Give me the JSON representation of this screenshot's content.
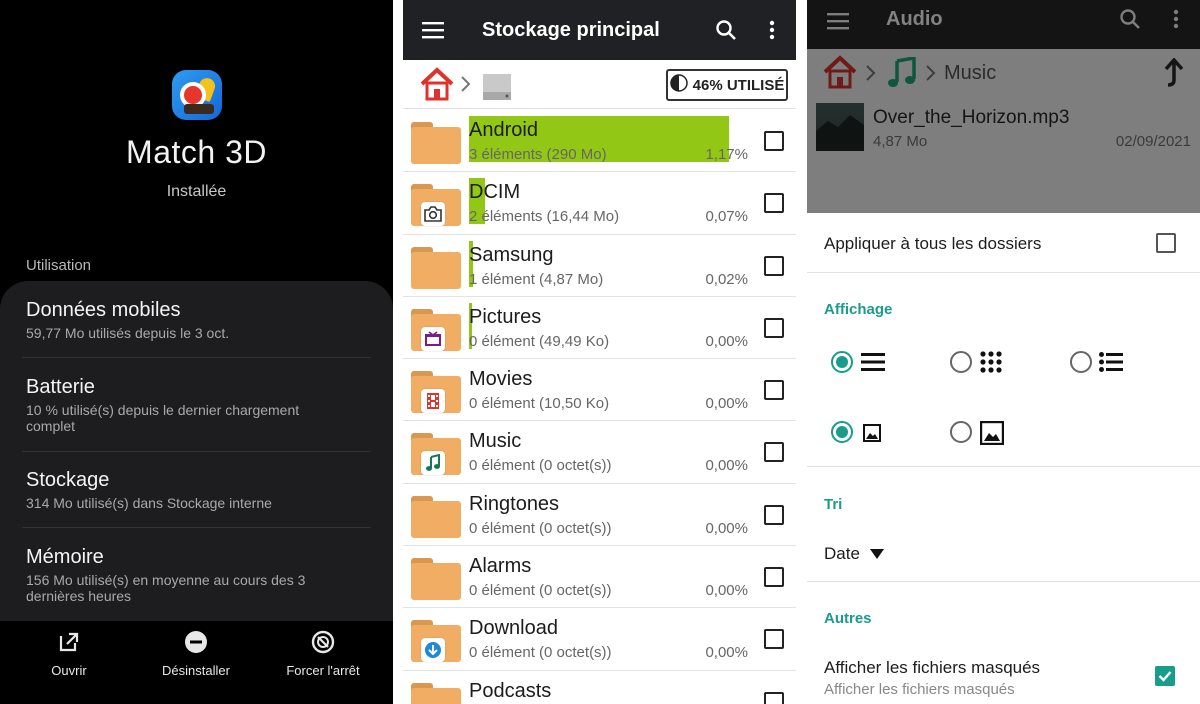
{
  "app_info": {
    "app_name": "Match 3D",
    "status": "Installée",
    "section_label": "Utilisation",
    "rows": [
      {
        "title": "Données mobiles",
        "subtitle": "59,77 Mo utilisés depuis le 3 oct."
      },
      {
        "title": "Batterie",
        "subtitle": "10 % utilisé(s) depuis le dernier chargement complet"
      },
      {
        "title": "Stockage",
        "subtitle": "314 Mo utilisé(s) dans Stockage interne"
      },
      {
        "title": "Mémoire",
        "subtitle": "156 Mo utilisé(s) en moyenne au cours des 3 dernières heures"
      }
    ],
    "actions": [
      {
        "label": "Ouvrir",
        "icon": "open-external-icon"
      },
      {
        "label": "Désinstaller",
        "icon": "uninstall-icon"
      },
      {
        "label": "Forcer l'arrêt",
        "icon": "force-stop-icon"
      }
    ]
  },
  "storage": {
    "title": "Stockage principal",
    "usage_label": "46% UTILISÉ",
    "bar_color": "#92c815",
    "folders": [
      {
        "name": "Android",
        "meta": "3 éléments (290 Mo)",
        "percent": "1,17%",
        "bar_fraction": 1.0,
        "icon": "folder-icon"
      },
      {
        "name": "DCIM",
        "meta": "2 éléments (16,44 Mo)",
        "percent": "0,07%",
        "bar_fraction": 0.06,
        "icon": "camera-icon"
      },
      {
        "name": "Samsung",
        "meta": "1 élément (4,87 Mo)",
        "percent": "0,02%",
        "bar_fraction": 0.017,
        "icon": "folder-icon"
      },
      {
        "name": "Pictures",
        "meta": "0 élément (49,49 Ko)",
        "percent": "0,00%",
        "bar_fraction": 0.004,
        "icon": "picture-icon"
      },
      {
        "name": "Movies",
        "meta": "0 élément (10,50 Ko)",
        "percent": "0,00%",
        "bar_fraction": 0,
        "icon": "film-icon"
      },
      {
        "name": "Music",
        "meta": "0 élément (0 octet(s))",
        "percent": "0,00%",
        "bar_fraction": 0,
        "icon": "music-note-icon"
      },
      {
        "name": "Ringtones",
        "meta": "0 élément (0 octet(s))",
        "percent": "0,00%",
        "bar_fraction": 0,
        "icon": "folder-icon"
      },
      {
        "name": "Alarms",
        "meta": "0 élément (0 octet(s))",
        "percent": "0,00%",
        "bar_fraction": 0,
        "icon": "folder-icon"
      },
      {
        "name": "Download",
        "meta": "0 élément (0 octet(s))",
        "percent": "0,00%",
        "bar_fraction": 0,
        "icon": "download-icon"
      },
      {
        "name": "Podcasts",
        "meta": "",
        "percent": "",
        "bar_fraction": 0,
        "icon": "folder-icon"
      }
    ]
  },
  "audio": {
    "title": "Audio",
    "breadcrumb_current": "Music",
    "file": {
      "name": "Over_the_Horizon.mp3",
      "size": "4,87 Mo",
      "date": "02/09/2021"
    },
    "apply_all_label": "Appliquer à tous les dossiers",
    "apply_all_checked": false,
    "display_section": "Affichage",
    "sort_section": "Tri",
    "sort_value": "Date",
    "other_section": "Autres",
    "hidden_files_label": "Afficher les fichiers masqués",
    "hidden_files_sub": "Afficher les fichiers masqués",
    "hidden_files_checked": true,
    "accent": "#1a9c8c"
  }
}
